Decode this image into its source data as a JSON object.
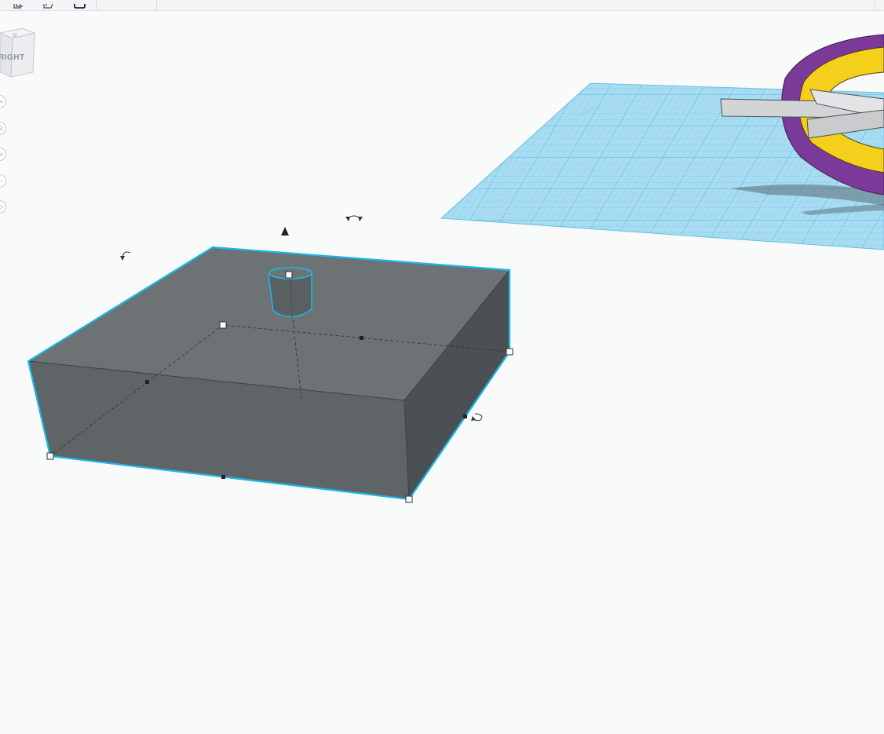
{
  "viewcube": {
    "face_label": "RIGHT"
  },
  "toolbar": {
    "buttons": [
      {
        "name": "copy-icon"
      },
      {
        "name": "paste-icon"
      },
      {
        "name": "delete-icon"
      }
    ]
  },
  "view_controls": [
    {
      "name": "home-view-button",
      "glyph": "+"
    },
    {
      "name": "fit-view-button",
      "glyph": "⊙"
    },
    {
      "name": "zoom-in-button",
      "glyph": "+"
    },
    {
      "name": "zoom-out-button",
      "glyph": "−"
    },
    {
      "name": "projection-toggle-button",
      "glyph": "◇"
    }
  ],
  "workplane": {
    "color": "#a7dcf2",
    "grid_color": "#7ac4e4"
  },
  "selected_shape": {
    "type": "box-with-cylinder",
    "top_color": "#6d7275",
    "front_color": "#5f6467",
    "side_color": "#4b5053",
    "outline_color": "#1ab8e8"
  },
  "other_shapes": {
    "ring_outer_color": "#7b3a99",
    "ring_inner_color": "#f4cf1c",
    "arrow_color": "#d2d4d5"
  }
}
